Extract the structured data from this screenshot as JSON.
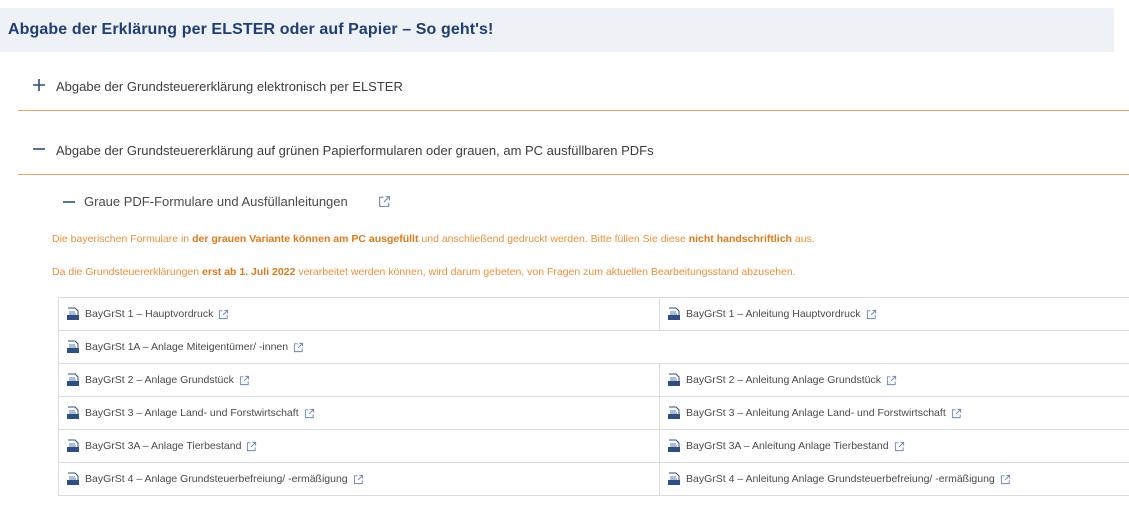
{
  "header": {
    "title": "Abgabe der Erklärung per ELSTER oder auf Papier – So geht's!"
  },
  "accordion": [
    {
      "symbol": "+",
      "label": "Abgabe der Grundsteuererklärung elektronisch per ELSTER",
      "expanded": false
    },
    {
      "symbol": "−",
      "label": "Abgabe der Grundsteuererklärung auf grünen Papierformularen oder grauen, am PC ausfüllbaren PDFs",
      "expanded": true
    }
  ],
  "sub_accordion": {
    "symbol": "−",
    "label": "Graue PDF-Formulare und Ausfüllanleitungen",
    "expanded": true
  },
  "notices": {
    "line1": {
      "a": "Die bayerischen Formulare in ",
      "b": "der grauen Variante können am PC ausgefüllt",
      "c": " und anschließend gedruckt werden. Bitte füllen Sie diese ",
      "d": "nicht handschriftlich",
      "e": " aus."
    },
    "line2": {
      "a": "Da die Grundsteuererklärungen ",
      "b": "erst ab 1. Juli 2022",
      "c": " verarbeitet werden können, wird darum gebeten, von Fragen zum aktuellen Bearbeitungsstand abzusehen."
    }
  },
  "documents": {
    "rows": [
      {
        "left": "BayGrSt 1 – Hauptvordruck",
        "right": "BayGrSt 1 – Anleitung Hauptvordruck"
      },
      {
        "left": "BayGrSt 1A – Anlage Miteigentümer/ -innen",
        "right": ""
      },
      {
        "left": "BayGrSt 2 – Anlage Grundstück",
        "right": "BayGrSt 2 – Anleitung Anlage Grundstück"
      },
      {
        "left": "BayGrSt 3 – Anlage Land- und Forstwirtschaft",
        "right": "BayGrSt 3 – Anleitung Anlage Land- und Forstwirtschaft"
      },
      {
        "left": "BayGrSt 3A – Anlage Tierbestand",
        "right": "BayGrSt 3A – Anleitung Anlage Tierbestand"
      },
      {
        "left": "BayGrSt 4 – Anlage Grundsteuerbefreiung/ -ermäßigung",
        "right": "BayGrSt 4 – Anleitung Anlage Grundsteuerbefreiung/ -ermäßigung"
      }
    ]
  },
  "icons": {
    "doc": "pdf-document-icon",
    "external": "external-link-icon",
    "plus": "plus-icon",
    "minus": "minus-icon"
  },
  "colors": {
    "title": "#1f3f74",
    "accent": "#f0a35a",
    "notice": "#e9913a",
    "icon_blue": "#2d4f86"
  }
}
